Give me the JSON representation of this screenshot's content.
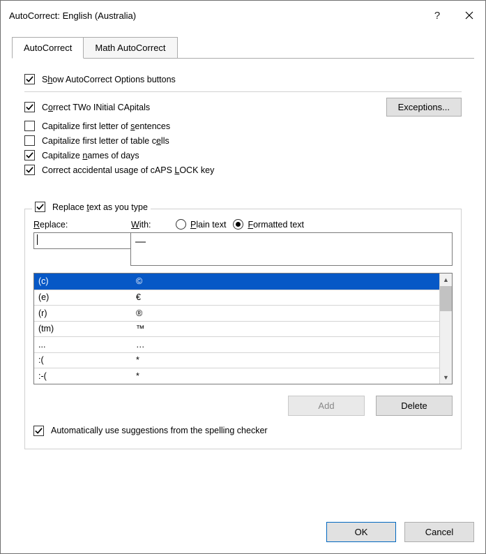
{
  "title": "AutoCorrect: English (Australia)",
  "tabs": {
    "autocorrect": "AutoCorrect",
    "math": "Math AutoCorrect"
  },
  "showOptions": {
    "pre": "S",
    "u": "h",
    "post": "ow AutoCorrect Options buttons",
    "checked": true
  },
  "options": [
    {
      "pre": "C",
      "u": "o",
      "post": "rrect TWo INitial CApitals",
      "checked": true
    },
    {
      "pre": "Capitalize first letter of ",
      "u": "s",
      "post": "entences",
      "checked": false
    },
    {
      "pre": "Capitalize first letter of table c",
      "u": "e",
      "post": "lls",
      "checked": false
    },
    {
      "pre": "Capitalize ",
      "u": "n",
      "post": "ames of days",
      "checked": true
    },
    {
      "pre": "Correct accidental usage of cAPS ",
      "u": "L",
      "post": "OCK key",
      "checked": true
    }
  ],
  "exceptions": "Exceptions...",
  "replaceGroup": {
    "pre": "Replace ",
    "u": "t",
    "post": "ext as you type",
    "checked": true
  },
  "labels": {
    "replace": {
      "u": "R",
      "post": "eplace:"
    },
    "with": {
      "u": "W",
      "post": "ith:"
    },
    "plain": {
      "u": "P",
      "post": "lain text"
    },
    "formatted": {
      "u": "F",
      "post": "ormatted text"
    }
  },
  "withValue": "—",
  "table": [
    {
      "r": "(c)",
      "w": "©",
      "sel": true
    },
    {
      "r": "(e)",
      "w": "€"
    },
    {
      "r": "(r)",
      "w": "®"
    },
    {
      "r": "(tm)",
      "w": "™"
    },
    {
      "r": "...",
      "w": "…"
    },
    {
      "r": ":(",
      "w": "*"
    },
    {
      "r": ":-(",
      "w": "*"
    }
  ],
  "buttons": {
    "add": "Add",
    "delete": "Delete"
  },
  "spellcheck": {
    "text": "Automatically use suggestions from the spelling checker",
    "checked": true
  },
  "footer": {
    "ok": "OK",
    "cancel": "Cancel"
  }
}
